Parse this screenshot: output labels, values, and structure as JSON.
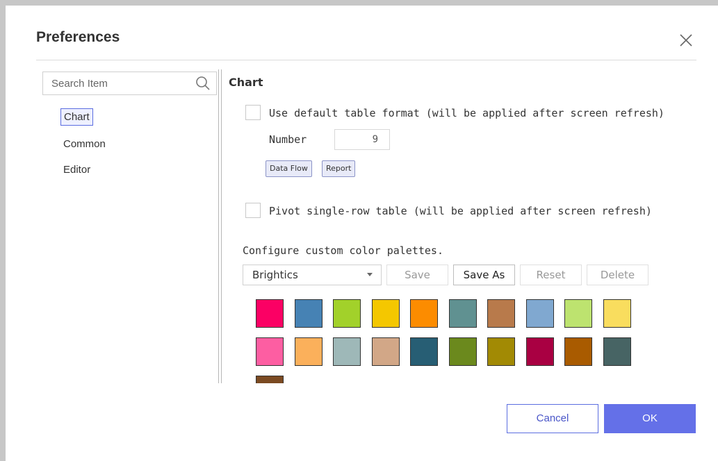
{
  "dialog": {
    "title": "Preferences"
  },
  "search": {
    "placeholder": "Search Item"
  },
  "sidebar": {
    "items": [
      {
        "label": "Chart",
        "active": true
      },
      {
        "label": "Common",
        "active": false
      },
      {
        "label": "Editor",
        "active": false
      }
    ]
  },
  "chart": {
    "section_title": "Chart",
    "default_table": {
      "label": "Use default table format (will be applied after screen refresh)",
      "checked": false,
      "number_label": "Number",
      "number_value": "9",
      "tags": [
        "Data Flow",
        "Report"
      ]
    },
    "pivot": {
      "label": "Pivot single-row table (will be applied after screen refresh)",
      "checked": false
    },
    "palette": {
      "heading": "Configure custom color palettes.",
      "selected": "Brightics",
      "buttons": {
        "save": "Save",
        "save_as": "Save As",
        "reset": "Reset",
        "delete": "Delete"
      },
      "colors": [
        "#fb0064",
        "#4682b4",
        "#a2d12a",
        "#f4c700",
        "#fc8c00",
        "#609191",
        "#b87a4b",
        "#80a8d0",
        "#bde36f",
        "#f9dd5e",
        "#fd5ea2",
        "#fbb05b",
        "#9eb8b8",
        "#d2a787",
        "#275e74",
        "#6b891d",
        "#a28a04",
        "#a90042",
        "#a95b00",
        "#476464",
        "#7b4a22"
      ]
    }
  },
  "footer": {
    "cancel": "Cancel",
    "ok": "OK"
  }
}
